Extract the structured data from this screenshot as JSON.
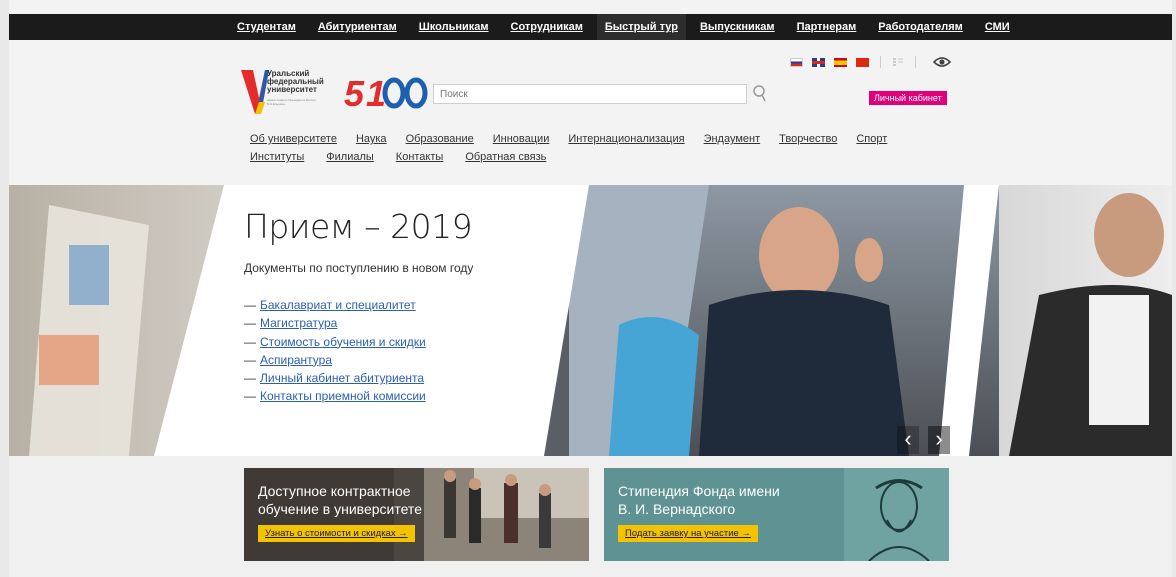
{
  "topnav": {
    "items": [
      {
        "label": "Студентам"
      },
      {
        "label": "Абитуриентам"
      },
      {
        "label": "Школьникам"
      },
      {
        "label": "Сотрудникам"
      },
      {
        "label": "Быстрый тур"
      },
      {
        "label": "Выпускникам"
      },
      {
        "label": "Партнерам"
      },
      {
        "label": "Работодателям"
      },
      {
        "label": "СМИ"
      }
    ]
  },
  "logo": {
    "line1": "Уральский",
    "line2": "федеральный",
    "line3": "университет",
    "sub": "имени первого Президента России Б.Н.Ельцина",
    "mark": "5100",
    "colors": {
      "red": "#e32c2c",
      "blue": "#1d5fb0",
      "yellow": "#f3c300"
    }
  },
  "search": {
    "placeholder": "Поиск",
    "icon": "search-icon"
  },
  "language_flags": [
    "ru",
    "en",
    "es",
    "cn"
  ],
  "cabinet_label": "Личный кабинет",
  "mainnav": {
    "row1": [
      "Об университете",
      "Наука",
      "Образование",
      "Инновации",
      "Интернационализация",
      "Эндаумент",
      "Творчество",
      "Спорт"
    ],
    "row2": [
      "Институты",
      "Филиалы",
      "Контакты",
      "Обратная связь"
    ]
  },
  "hero": {
    "title": "Прием – 2019",
    "subtitle": "Документы по поступлению в новом году",
    "links": [
      "Бакалавриат и специалитет",
      "Магистратура",
      "Стоимость обучения и скидки",
      "Аспирантура",
      "Личный кабинет абитуриента",
      "Контакты приемной комиссии"
    ],
    "prev_label": "‹",
    "next_label": "›"
  },
  "promos": [
    {
      "title_line1": "Доступное контрактное",
      "title_line2": "обучение в университете",
      "button": "Узнать о стоимости и скидках →",
      "bg": "#403b35"
    },
    {
      "title_line1": "Стипендия Фонда имени",
      "title_line2": "В. И. Вернадского",
      "button": "Подать заявку на участие →",
      "bg": "#5f9393"
    }
  ],
  "accent": {
    "pink": "#e0007a",
    "button_yellow": "#f3c300",
    "link": "#2b5fb3"
  }
}
